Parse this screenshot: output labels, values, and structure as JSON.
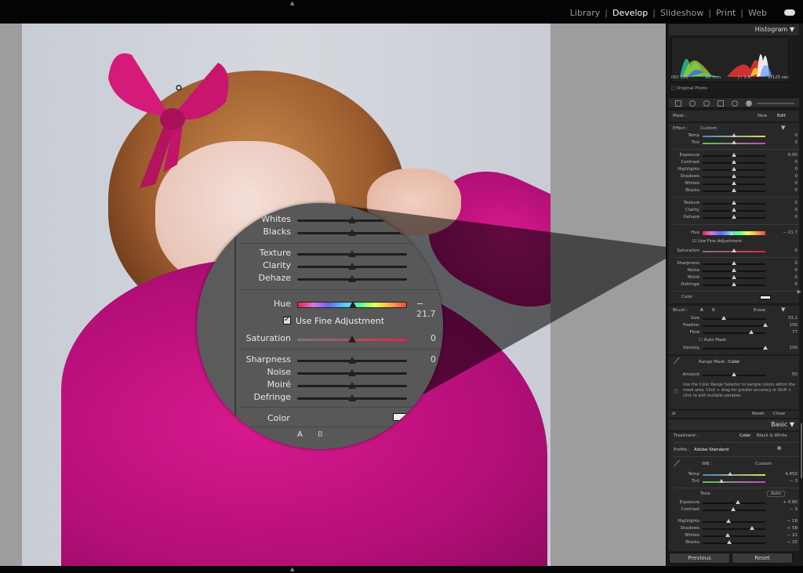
{
  "topbar": {
    "modules": [
      "Library",
      "Develop",
      "Slideshow",
      "Print",
      "Web"
    ],
    "active": "Develop"
  },
  "magnifier": {
    "rows": [
      {
        "label": "Whites"
      },
      {
        "label": "Blacks"
      },
      {
        "label": "Texture"
      },
      {
        "label": "Clarity"
      },
      {
        "label": "Dehaze"
      },
      {
        "label": "Hue",
        "value": "− 21.7"
      },
      {
        "label": "Saturation",
        "value": "0"
      },
      {
        "label": "Sharpness",
        "value": "0"
      },
      {
        "label": "Noise"
      },
      {
        "label": "Moiré"
      },
      {
        "label": "Defringe"
      }
    ],
    "fine_adjust": "Use Fine Adjustment",
    "color_label": "Color",
    "ab": [
      "A",
      "B"
    ]
  },
  "panel": {
    "histogram_title": "Histogram",
    "histogram_meta": [
      "ISO 100",
      "85 mm",
      "ƒ / 1.6",
      "1/125 sec"
    ],
    "original_photo": "Original Photo",
    "mask": {
      "label": "Mask :",
      "new": "New",
      "edit": "Edit"
    },
    "effect": {
      "label": "Effect :",
      "value": "Custom"
    },
    "temp_tint": [
      {
        "label": "Temp",
        "value": "0"
      },
      {
        "label": "Tint",
        "value": "0"
      }
    ],
    "tone": [
      {
        "label": "Exposure",
        "value": "0.00"
      },
      {
        "label": "Contrast",
        "value": "0"
      },
      {
        "label": "Highlights",
        "value": "0"
      },
      {
        "label": "Shadows",
        "value": "0"
      },
      {
        "label": "Whites",
        "value": "0"
      },
      {
        "label": "Blacks",
        "value": "0"
      }
    ],
    "presence": [
      {
        "label": "Texture",
        "value": "0"
      },
      {
        "label": "Clarity",
        "value": "0"
      },
      {
        "label": "Dehaze",
        "value": "0"
      }
    ],
    "hue": {
      "label": "Hue",
      "value": "− 21.7"
    },
    "fine_adjust": "Use Fine Adjustment",
    "saturation": {
      "label": "Saturation",
      "value": "0"
    },
    "detail": [
      {
        "label": "Sharpness",
        "value": "0"
      },
      {
        "label": "Noise",
        "value": "0"
      },
      {
        "label": "Moiré",
        "value": "0"
      },
      {
        "label": "Defringe",
        "value": "0"
      }
    ],
    "color_label": "Color",
    "brush": {
      "label": "Brush :",
      "a": "A",
      "b": "B",
      "erase": "Erase"
    },
    "brush_rows": [
      {
        "label": "Size",
        "value": "33.1"
      },
      {
        "label": "Feather",
        "value": "100"
      },
      {
        "label": "Flow",
        "value": "77"
      }
    ],
    "auto_mask": "Auto Mask",
    "density": {
      "label": "Density",
      "value": "100"
    },
    "range_mask": {
      "label": "Range Mask :",
      "value": "Color"
    },
    "amount": {
      "label": "Amount",
      "value": "50"
    },
    "help": "Use the Color Range Selector to sample colors within the mask area. Click + drag for greater accuracy or Shift + click to add multiple samples.",
    "reset": "Reset",
    "close": "Close",
    "basic_title": "Basic",
    "treatment": {
      "label": "Treatment :",
      "color": "Color",
      "bw": "Black & White"
    },
    "profile": {
      "label": "Profile :",
      "value": "Adobe Standard"
    },
    "wb": {
      "label": "WB :",
      "value": "Custom"
    },
    "basic_temp": [
      {
        "label": "Temp",
        "value": "4,850"
      },
      {
        "label": "Tint",
        "value": "− 3"
      }
    ],
    "tone_label": "Tone",
    "auto": "Auto",
    "basic_ec": [
      {
        "label": "Exposure",
        "value": "+ 0.80"
      },
      {
        "label": "Contrast",
        "value": "− 3"
      }
    ],
    "basic_hs": [
      {
        "label": "Highlights",
        "value": "− 18"
      },
      {
        "label": "Shadows",
        "value": "+ 58"
      },
      {
        "label": "Whites",
        "value": "− 21"
      },
      {
        "label": "Blacks",
        "value": "− 15"
      }
    ],
    "previous": "Previous",
    "reset_btn": "Reset"
  }
}
